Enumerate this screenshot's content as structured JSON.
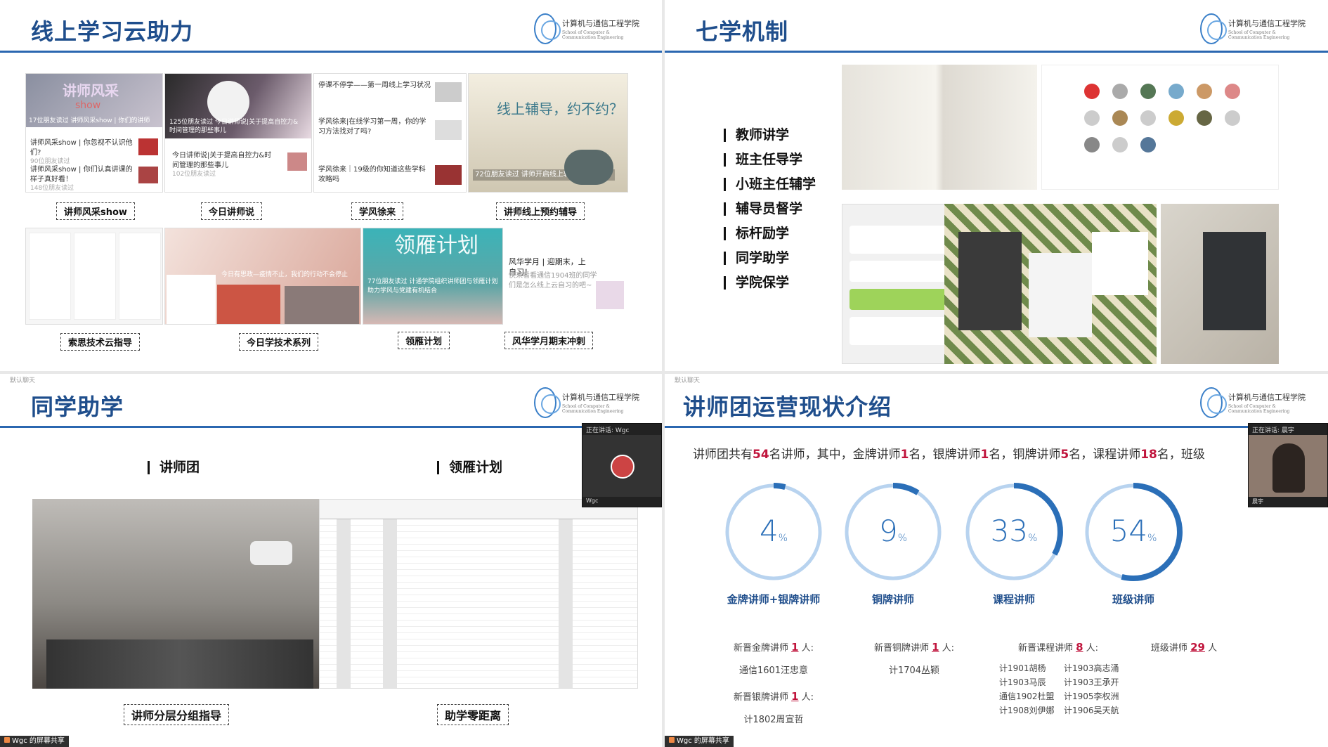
{
  "logo": {
    "school_cn": "计算机与通信工程学院",
    "school_en": "School of Computer & Communication Engineering"
  },
  "panel1": {
    "title": "线上学习云助力",
    "thumbs": {
      "a_caption": "讲师风采",
      "a_big": "讲师风采show",
      "a_sub": "17位朋友读过 讲师风采show | 你们的讲师",
      "b_caption": "125位朋友读过 今日讲师说|关于提高自控力&时间管理的那些事儿",
      "news1_title": "停课不停学——第一周线上学习状况",
      "news2_title": "学风徐来|在线学习第一周，你的学习方法找对了吗?",
      "news3_title": "学风徐来｜19级的你知道这些学科攻略吗",
      "left_news1": "讲师风采show | 你忽视不认识他们?",
      "left_news1_meta": "90位朋友读过",
      "left_news2": "讲师风采show | 你们认真讲课的样子真好看！",
      "left_news2_meta": "148位朋友读过",
      "mid_news": "今日讲师说|关于提高自控力&时间管理的那些事儿",
      "mid_news_meta": "102位朋友读过",
      "d_big": "线上辅导，约不约？",
      "d_sub": "72位朋友读过 讲师开启线上辅导，约不约？",
      "f_sub": "今日有思政—疫情不止，我们的行动不会停止",
      "g_big": "领雁计划",
      "g_sub": "77位朋友读过 计通学院组织讲师团与领雁计划助力学风与党建有机结合",
      "h_title": "风华学月 | 迎期末，上自习！",
      "h_sub": "快来看看通信1904班的同学们是怎么线上云自习的吧~"
    },
    "tags": [
      "讲师风采show",
      "今日讲师说",
      "学风徐来",
      "讲师线上预约辅导",
      "索思技术云指导",
      "今日学技术系列",
      "领雁计划",
      "风华学月期末冲刺"
    ]
  },
  "panel2": {
    "title": "七学机制",
    "items": [
      "教师讲学",
      "班主任导学",
      "小班主任辅学",
      "辅导员督学",
      "标杆励学",
      "同学助学",
      "学院保学"
    ]
  },
  "panel3": {
    "title": "同学助学",
    "head_left": "讲师团",
    "head_right": "领雁计划",
    "tag_left": "讲师分层分组指导",
    "tag_right": "助学零距离",
    "video_top": "正在讲话: Wgc",
    "video_bottom": "Wgc",
    "share": "Wgc 的屏幕共享",
    "watermark": "默认聊天"
  },
  "panel4": {
    "title": "讲师团运营现状介绍",
    "summary_pre": "讲师团共有",
    "summary_n1": "54",
    "summary_t1": "名讲师，其中，金牌讲师",
    "summary_n2": "1",
    "summary_t2": "名，银牌讲师",
    "summary_n3": "1",
    "summary_t3": "名，铜牌讲师",
    "summary_n4": "5",
    "summary_t4": "名，课程讲师",
    "summary_n5": "18",
    "summary_t5": "名，班级",
    "rings": [
      {
        "value": "4",
        "unit": "%",
        "label": "金牌讲师+银牌讲师"
      },
      {
        "value": "9",
        "unit": "%",
        "label": "铜牌讲师"
      },
      {
        "value": "33",
        "unit": "%",
        "label": "课程讲师"
      },
      {
        "value": "54",
        "unit": "%",
        "label": "班级讲师"
      }
    ],
    "notes": {
      "gold_pre": "新晋金牌讲师",
      "gold_n": "1",
      "gold_post": "人:",
      "gold_name": "通信1601汪忠意",
      "silver_pre": "新晋银牌讲师",
      "silver_n": "1",
      "silver_post": "人:",
      "silver_name": "计1802周宣哲",
      "bronze_pre": "新晋铜牌讲师",
      "bronze_n": "1",
      "bronze_post": "人:",
      "bronze_name": "计1704丛颖",
      "course_pre": "新晋课程讲师",
      "course_n": "8",
      "course_post": "人:",
      "course_names": [
        "计1901胡杨",
        "计1903高志涌",
        "计1903马辰",
        "计1903王承开",
        "通信1902杜盟",
        "计1905李权洲",
        "计1908刘伊娜",
        "计1906吴天航"
      ],
      "class_pre": "班级讲师",
      "class_n": "29",
      "class_post": "人"
    },
    "video_top": "正在讲话: 晨宇",
    "video_bottom": "晨宇",
    "share": "Wgc 的屏幕共享",
    "watermark": "默认聊天"
  },
  "colors": {
    "title": "#1f4e8c",
    "accent_line": "#2b67b0",
    "ring": "#2b6fb8",
    "ring_bg": "#b8d3ef",
    "highlight": "#c0143c"
  }
}
